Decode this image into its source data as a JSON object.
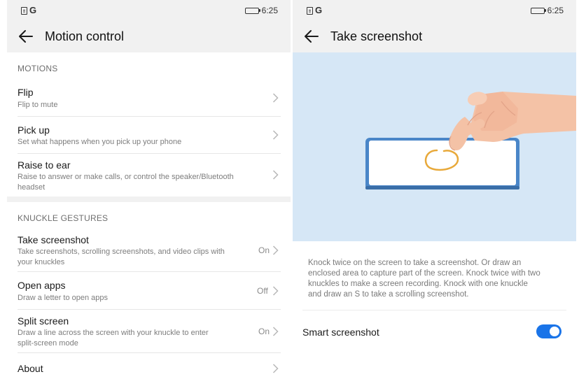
{
  "status_bar": {
    "time": "6:25",
    "g_label": "G"
  },
  "left": {
    "title": "Motion control",
    "sections": [
      {
        "header": "MOTIONS",
        "items": [
          {
            "title": "Flip",
            "subtitle": "Flip to mute",
            "value": ""
          },
          {
            "title": "Pick up",
            "subtitle": "Set what happens when you pick up your phone",
            "value": ""
          },
          {
            "title": "Raise to ear",
            "subtitle_lines": [
              "Raise to answer or make calls, or control the speaker/Bluetooth",
              "headset"
            ],
            "value": ""
          }
        ]
      },
      {
        "header": "KNUCKLE GESTURES",
        "items": [
          {
            "title": "Take screenshot",
            "subtitle_lines": [
              "Take screenshots, scrolling screenshots, and video clips with",
              "your knuckles"
            ],
            "value": "On"
          },
          {
            "title": "Open apps",
            "subtitle": "Draw a letter to open apps",
            "value": "Off"
          },
          {
            "title": "Split screen",
            "subtitle_lines": [
              "Draw a line across the screen with your knuckle to enter",
              "split-screen mode"
            ],
            "value": "On"
          },
          {
            "title": "About",
            "subtitle": "",
            "value": ""
          }
        ]
      }
    ]
  },
  "right": {
    "title": "Take screenshot",
    "description_lines": [
      "Knock twice on the screen to take a screenshot. Or draw an",
      "enclosed area to capture part of the screen. Knock twice with two",
      "knuckles to make a screen recording. Knock with one knuckle",
      "and draw an S to take a scrolling screenshot."
    ],
    "smart_screenshot": {
      "label": "Smart screenshot",
      "enabled": true
    }
  },
  "colors": {
    "accent": "#1a74e8",
    "header_bg": "#f1f1f1",
    "illustration_bg": "#d6e7f6",
    "phone_frame": "#4a86c8",
    "gesture_circle": "#e8a93a",
    "skin": "#f4c2a6"
  },
  "icons": [
    "back-arrow-icon",
    "chevron-right-icon",
    "battery-icon",
    "document-icon"
  ]
}
